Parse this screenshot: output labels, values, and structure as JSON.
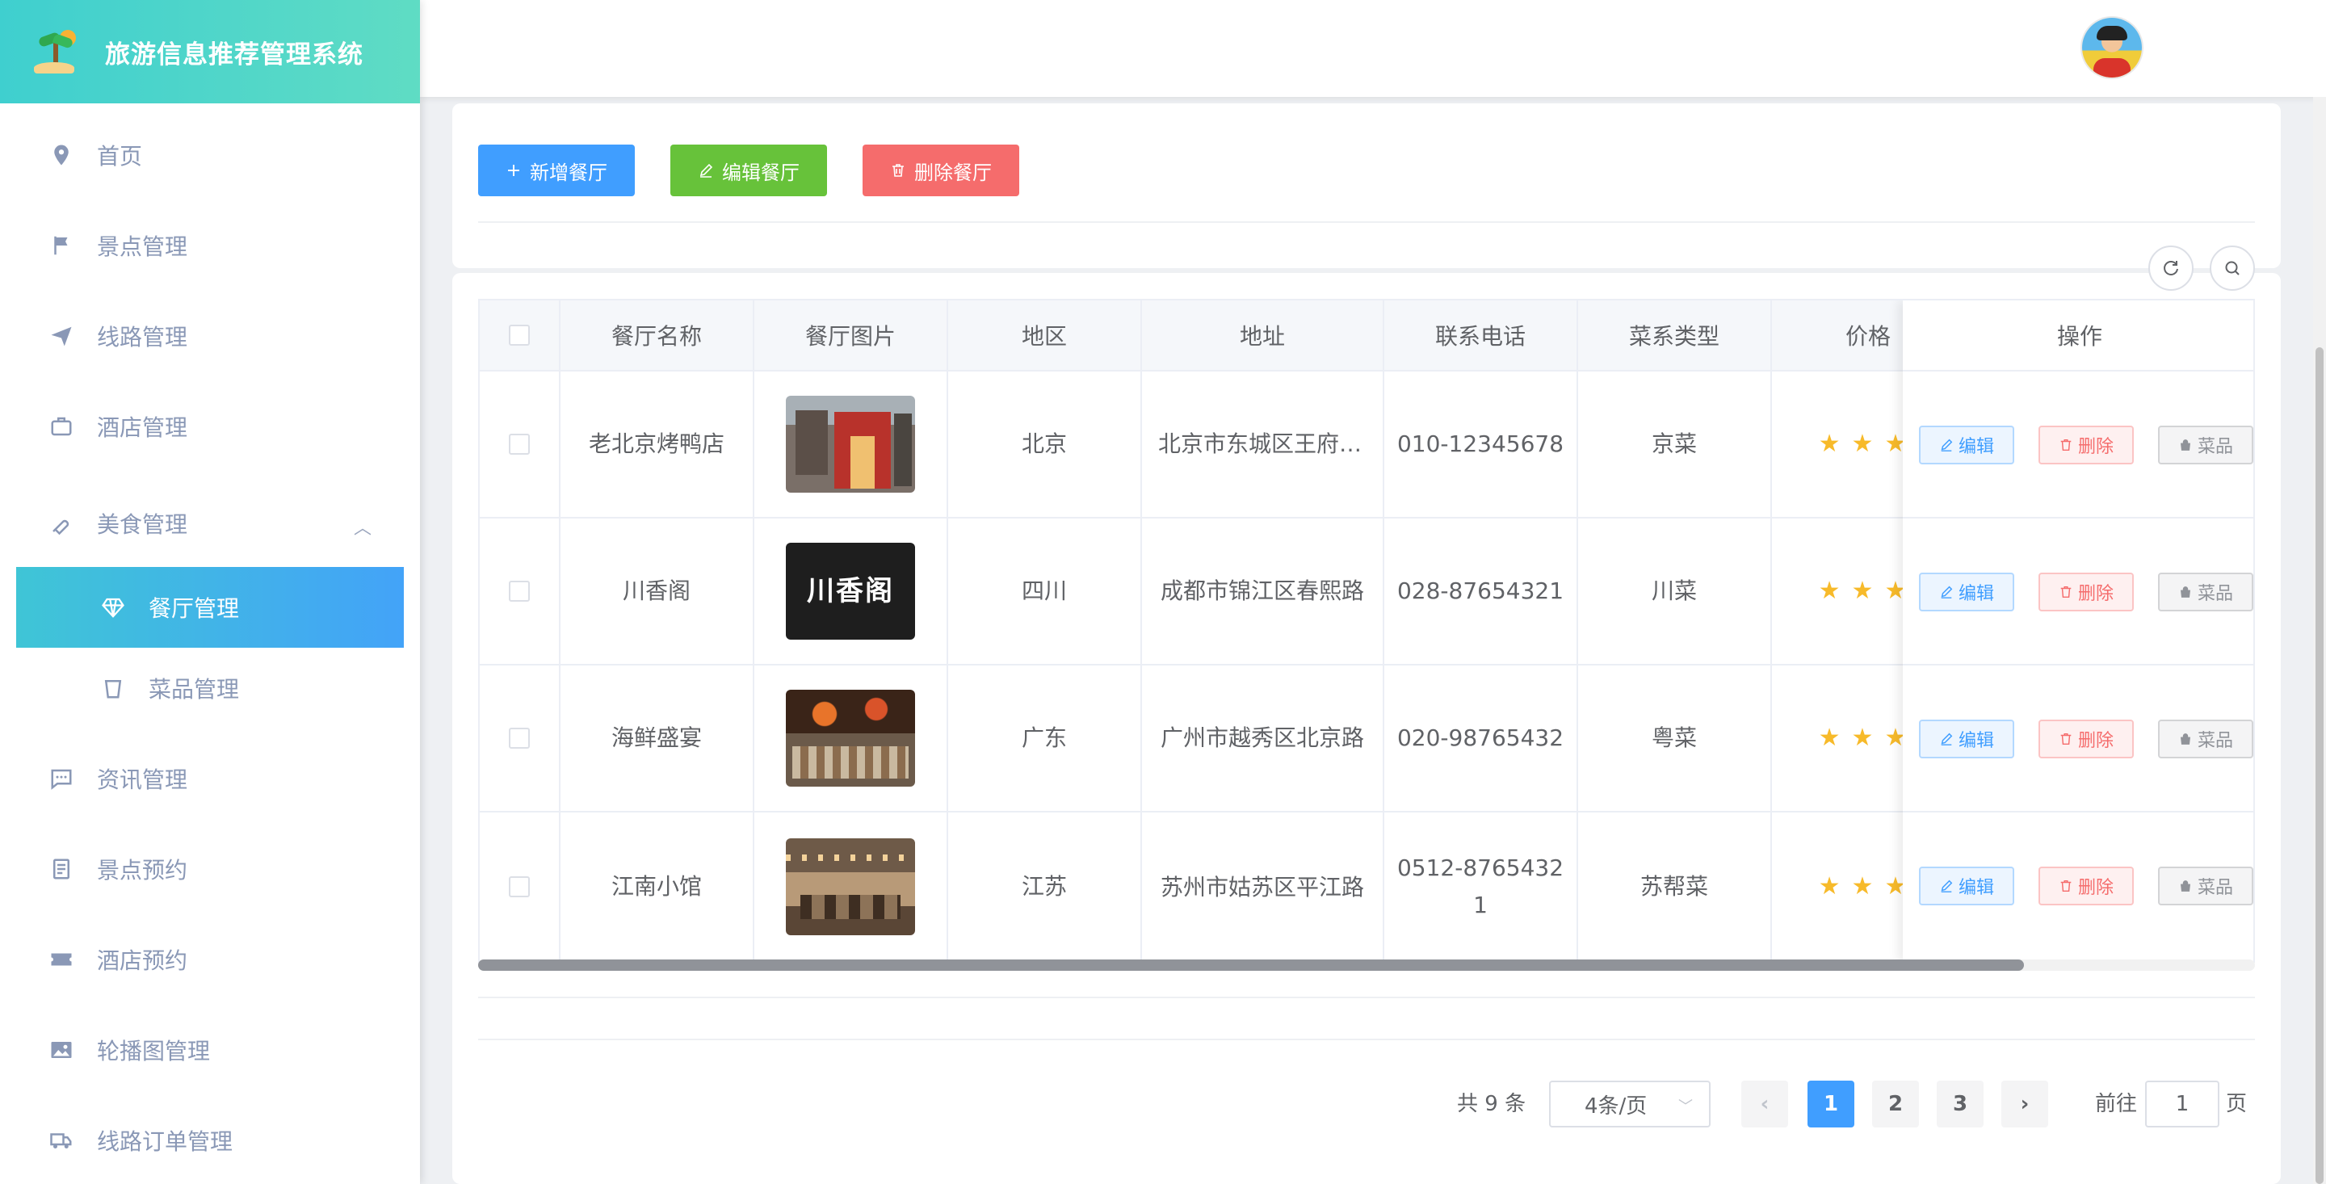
{
  "app": {
    "title": "旅游信息推荐管理系统"
  },
  "sidebar": {
    "items": [
      {
        "label": "首页",
        "icon": "location-icon"
      },
      {
        "label": "景点管理",
        "icon": "flag-icon"
      },
      {
        "label": "线路管理",
        "icon": "paper-plane-icon"
      },
      {
        "label": "酒店管理",
        "icon": "suitcase-icon"
      },
      {
        "label": "美食管理",
        "icon": "ice-cream-icon"
      },
      {
        "label": "餐厅管理",
        "icon": "diamond-icon"
      },
      {
        "label": "菜品管理",
        "icon": "cup-icon"
      },
      {
        "label": "资讯管理",
        "icon": "chat-icon"
      },
      {
        "label": "景点预约",
        "icon": "document-icon"
      },
      {
        "label": "酒店预约",
        "icon": "ticket-icon"
      },
      {
        "label": "轮播图管理",
        "icon": "picture-icon"
      },
      {
        "label": "线路订单管理",
        "icon": "truck-icon"
      }
    ],
    "active": "餐厅管理"
  },
  "toolbar": {
    "add_label": "新增餐厅",
    "edit_label": "编辑餐厅",
    "delete_label": "删除餐厅"
  },
  "table": {
    "columns": [
      "餐厅名称",
      "餐厅图片",
      "地区",
      "地址",
      "联系电话",
      "菜系类型",
      "价格",
      "操作"
    ],
    "rows": [
      {
        "name": "老北京烤鸭店",
        "region": "北京",
        "address": "北京市东城区王府井大街",
        "phone": "010-12345678",
        "cuisine": "京菜",
        "stars": 3,
        "image": "restaurant-storefront"
      },
      {
        "name": "川香阁",
        "region": "四川",
        "address": "成都市锦江区春熙路",
        "phone": "028-87654321",
        "cuisine": "川菜",
        "stars": 3,
        "image": "chuanxiangge-logo",
        "logo_text": "川香阁"
      },
      {
        "name": "海鲜盛宴",
        "region": "广东",
        "address": "广州市越秀区北京路",
        "phone": "020-98765432",
        "cuisine": "粤菜",
        "stars": 3,
        "image": "seafood-market"
      },
      {
        "name": "江南小馆",
        "region": "江苏",
        "address": "苏州市姑苏区平江路",
        "phone": "0512-87654321",
        "cuisine": "苏帮菜",
        "stars": 3,
        "image": "restaurant-interior"
      }
    ],
    "op_edit": "编辑",
    "op_delete": "删除",
    "op_dish": "菜品",
    "scroll_position": 0.87
  },
  "pagination": {
    "total": "共 9 条",
    "page_size": "4条/页",
    "pages": [
      "1",
      "2",
      "3"
    ],
    "current": "1",
    "goto_label": "前往",
    "goto_value": "1",
    "page_label": "页",
    "prev_icon": "chevron-left-icon",
    "next_icon": "chevron-right-icon"
  },
  "colors": {
    "primary": "#409eff",
    "success": "#67c23a",
    "danger": "#f56c6c",
    "brand_gradient_start": "#3fcfcf",
    "star": "#f7ba2a"
  }
}
